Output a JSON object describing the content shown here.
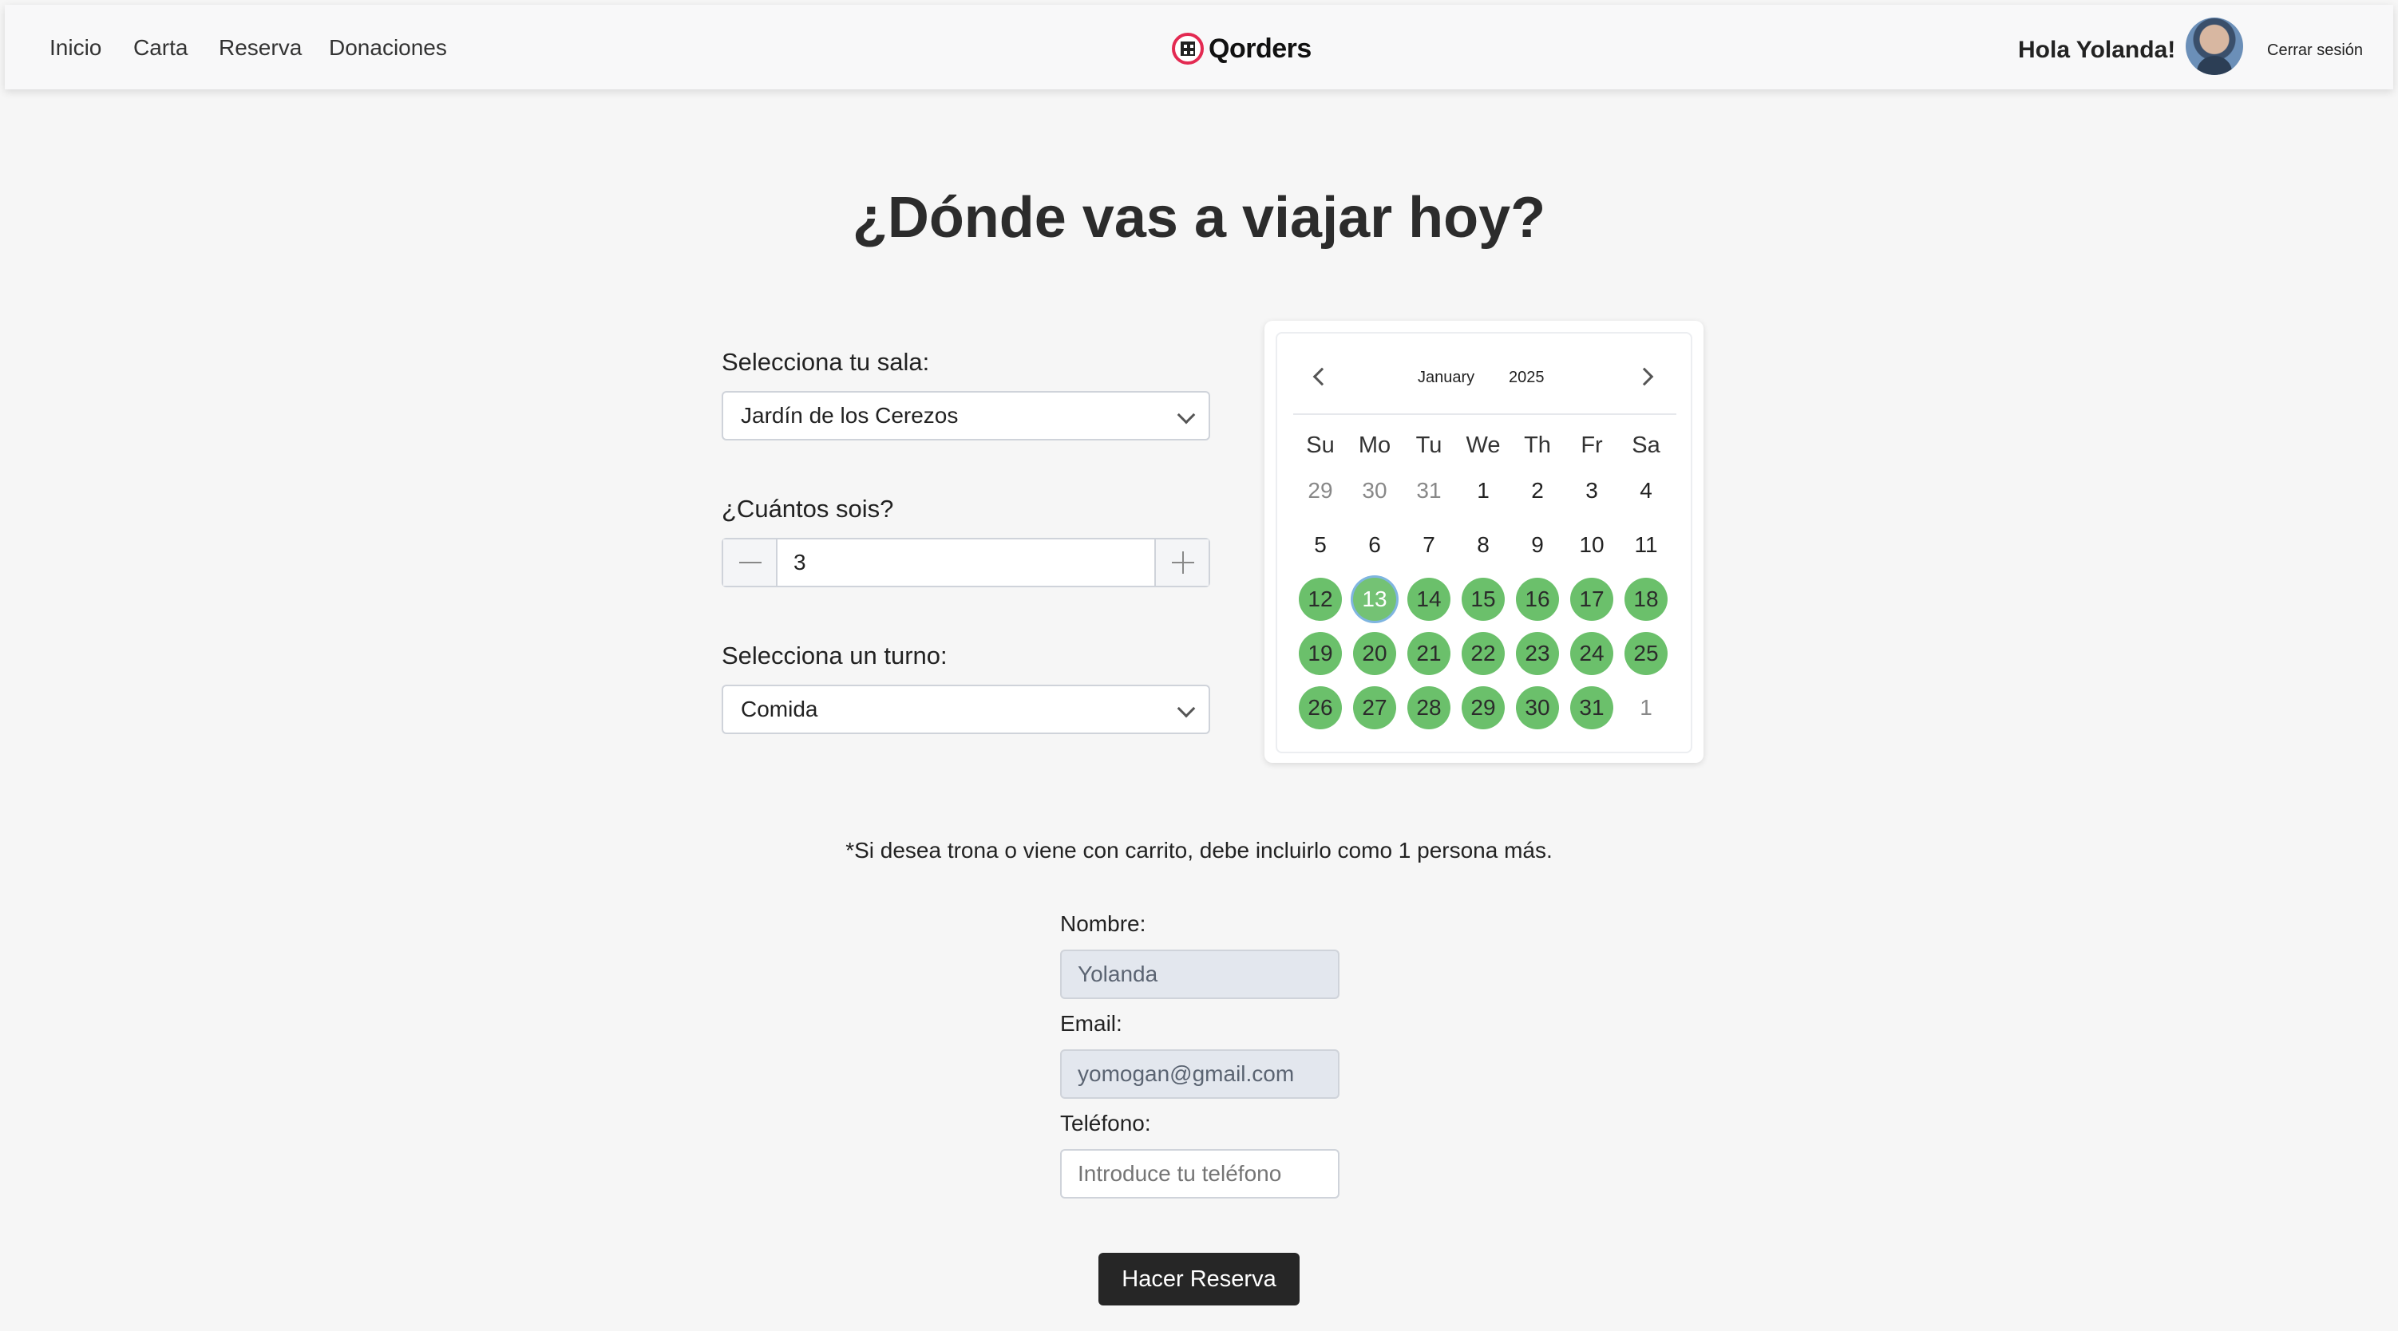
{
  "nav": {
    "links": [
      "Inicio",
      "Carta",
      "Reserva",
      "Donaciones"
    ],
    "logo_text": "Qorders",
    "greeting": "Hola Yolanda!",
    "logout": "Cerrar sesión"
  },
  "page": {
    "title": "¿Dónde vas a viajar hoy?",
    "note": "*Si desea trona o viene con carrito, debe incluirlo como 1 persona más."
  },
  "form": {
    "room_label": "Selecciona tu sala:",
    "room_value": "Jardín de los Cerezos",
    "people_label": "¿Cuántos sois?",
    "people_value": "3",
    "shift_label": "Selecciona un turno:",
    "shift_value": "Comida",
    "name_label": "Nombre:",
    "name_value": "Yolanda",
    "email_label": "Email:",
    "email_value": "yomogan@gmail.com",
    "phone_label": "Teléfono:",
    "phone_placeholder": "Introduce tu teléfono",
    "submit_label": "Hacer Reserva"
  },
  "calendar": {
    "month": "January",
    "year": "2025",
    "weekdays": [
      "Su",
      "Mo",
      "Tu",
      "We",
      "Th",
      "Fr",
      "Sa"
    ],
    "weeks": [
      [
        {
          "d": "29",
          "s": "muted"
        },
        {
          "d": "30",
          "s": "muted"
        },
        {
          "d": "31",
          "s": "muted"
        },
        {
          "d": "1",
          "s": ""
        },
        {
          "d": "2",
          "s": ""
        },
        {
          "d": "3",
          "s": ""
        },
        {
          "d": "4",
          "s": ""
        }
      ],
      [
        {
          "d": "5",
          "s": ""
        },
        {
          "d": "6",
          "s": ""
        },
        {
          "d": "7",
          "s": ""
        },
        {
          "d": "8",
          "s": ""
        },
        {
          "d": "9",
          "s": ""
        },
        {
          "d": "10",
          "s": ""
        },
        {
          "d": "11",
          "s": ""
        }
      ],
      [
        {
          "d": "12",
          "s": "avail"
        },
        {
          "d": "13",
          "s": "selected"
        },
        {
          "d": "14",
          "s": "avail"
        },
        {
          "d": "15",
          "s": "avail"
        },
        {
          "d": "16",
          "s": "avail"
        },
        {
          "d": "17",
          "s": "avail"
        },
        {
          "d": "18",
          "s": "avail"
        }
      ],
      [
        {
          "d": "19",
          "s": "avail"
        },
        {
          "d": "20",
          "s": "avail"
        },
        {
          "d": "21",
          "s": "avail"
        },
        {
          "d": "22",
          "s": "avail"
        },
        {
          "d": "23",
          "s": "avail"
        },
        {
          "d": "24",
          "s": "avail"
        },
        {
          "d": "25",
          "s": "avail"
        }
      ],
      [
        {
          "d": "26",
          "s": "avail"
        },
        {
          "d": "27",
          "s": "avail"
        },
        {
          "d": "28",
          "s": "avail"
        },
        {
          "d": "29",
          "s": "avail"
        },
        {
          "d": "30",
          "s": "avail"
        },
        {
          "d": "31",
          "s": "avail"
        },
        {
          "d": "1",
          "s": "muted"
        }
      ]
    ]
  },
  "colors": {
    "available_day": "#6bc06b",
    "selected_ring": "#7fb5e0",
    "brand": "#e32a52",
    "button": "#262626"
  }
}
